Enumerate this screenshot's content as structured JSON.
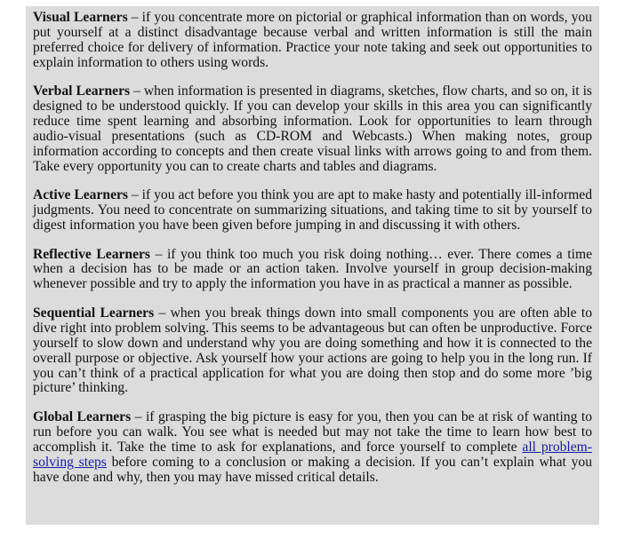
{
  "paragraphs": [
    {
      "term": "Visual Learners",
      "text": " – if you concentrate more on pictorial or graphical information than on words, you put yourself at a distinct disadvantage because verbal and written information is still the main preferred choice for delivery of information. Practice your note taking and seek out opportunities to explain information to others using words."
    },
    {
      "term": "Verbal Learners",
      "text": " – when information is presented in diagrams, sketches, flow charts, and so on, it is designed to be understood quickly. If you can develop your skills in this area you can significantly reduce time spent learning and absorbing information. Look for opportunities to learn through audio-visual presentations (such as CD-ROM and Webcasts.) When making notes, group information according to concepts and then create visual links with arrows going to and from them. Take every opportunity you can to create charts and tables and diagrams."
    },
    {
      "term": "Active Learners",
      "text": " – if you act before you think you are apt to make hasty and potentially ill-informed judgments. You need to concentrate on summarizing situations, and taking time to sit by yourself to digest information you have been given before jumping in and discussing it with others."
    },
    {
      "term": "Reflective Learners",
      "text": " – if you think too much you risk doing nothing… ever. There comes a time when a decision has to be made or an action taken. Involve yourself in group decision-making whenever possible and try to apply the information you have in as practical a manner as possible."
    },
    {
      "term": "Sequential Learners",
      "text": " – when you break things down into small components you are often able to dive right into problem solving. This seems to be advantageous but can often be unproductive. Force yourself to slow down and understand why you are doing something and how it is connected to the overall purpose or objective. Ask yourself how your actions are going to help you in the long run. If you can’t think of a practical application for what you are doing then stop and do some more ’big picture’ thinking."
    },
    {
      "term": "Global Learners",
      "text_before": " – if grasping the big picture is easy for you, then you can be at risk of wanting to run before you can walk. You see what is needed but may not take the time to learn how best to accomplish it. Take the time to ask for explanations, and force yourself to complete ",
      "link": "all problem-solving steps",
      "text_after": " before coming to a conclusion or making a decision. If you can’t explain what you have done and why, then you may have missed critical details."
    }
  ],
  "colors": {
    "panel_background": "#dcdcdc",
    "text": "#111111",
    "link": "#1a1aa6"
  }
}
